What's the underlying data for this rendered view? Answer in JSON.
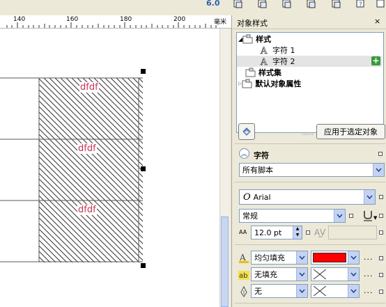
{
  "toolbar": {
    "zoom_label": "6.0",
    "buttons": [
      "page-fit-icon",
      "page-copy-icon",
      "page-flip-icon",
      "page-layout-icon",
      "page-export-icon",
      "help-icon",
      "page-settings-icon"
    ]
  },
  "ruler": {
    "ticks": [
      "140",
      "160",
      "180",
      "200"
    ],
    "unit": "毫米"
  },
  "canvas": {
    "cells": [
      {
        "text": "dfdf"
      },
      {
        "text": "dfdf"
      },
      {
        "text": "dfdf"
      }
    ],
    "accent": "#cc3355"
  },
  "docker": {
    "title": "对象样式",
    "close": "×",
    "tree": {
      "styles_label": "样式",
      "char1": "字符 1",
      "char2": "字符 2",
      "stylesets_label": "样式集",
      "defaults_label": "默认对象属性"
    },
    "apply_button": "应用于选定对象",
    "char_section": {
      "title": "字符",
      "script_value": "所有脚本",
      "font_value": "Arial",
      "font_style_value": "常规",
      "font_size_value": "12.0 pt",
      "font_size_prefix": "AA",
      "fill_rows": [
        {
          "icon": "text-fill-icon",
          "type": "均匀填充",
          "swatch": "#ff0000"
        },
        {
          "icon": "background-fill-icon",
          "type": "无填充",
          "swatch": "none"
        },
        {
          "icon": "outline-pen-icon",
          "type": "无",
          "swatch": "none"
        }
      ],
      "more": "..."
    }
  }
}
